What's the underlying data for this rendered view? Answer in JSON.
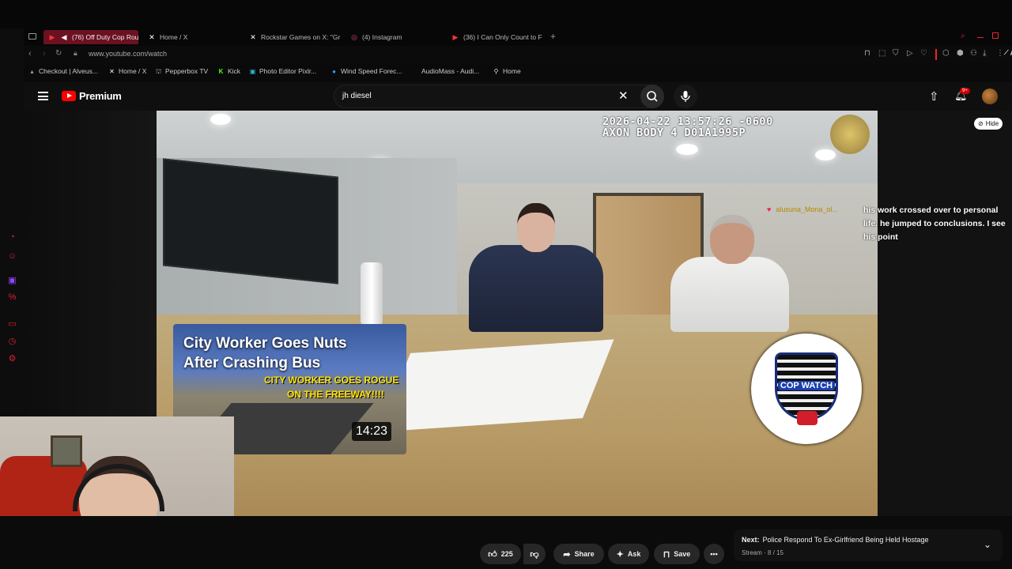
{
  "browser": {
    "tabs": [
      {
        "label": "(76) Off Duty Cop Roug",
        "icon": "youtube-icon",
        "active": true
      },
      {
        "label": "Home / X",
        "icon": "x-icon"
      },
      {
        "label": "Rockstar Games on X: \"Gr",
        "icon": "x-icon"
      },
      {
        "label": "(4) Instagram",
        "icon": "instagram-icon"
      },
      {
        "label": "(36) I Can Only Count to F",
        "icon": "youtube-icon"
      }
    ],
    "url": "www.youtube.com/watch",
    "bookmarks": [
      {
        "label": "Checkout | Alveus...",
        "icon": "shop-icon"
      },
      {
        "label": "Home / X",
        "icon": "x-icon"
      },
      {
        "label": "Pepperbox TV",
        "icon": "tv-icon"
      },
      {
        "label": "Kick",
        "icon": "kick-icon"
      },
      {
        "label": "Photo Editor Pixlr...",
        "icon": "pixlr-icon"
      },
      {
        "label": "Wind Speed Forec...",
        "icon": "globe-icon"
      },
      {
        "label": "AudioMass - Audi...",
        "icon": "audio-icon"
      },
      {
        "label": "Home",
        "icon": "pin-icon"
      }
    ],
    "ai_label": "AI",
    "accent": "#ff3040"
  },
  "youtube": {
    "brand": "Premium",
    "search_value": "jh diesel",
    "notification_count": "9+",
    "video": {
      "timestamp_line1": "2026-04-22 13:57:26 -0600",
      "timestamp_line2": "AXON BODY 4 D01A1995P",
      "hide_label": "Hide",
      "chat_user": "alusuna_Mona_ol...",
      "chat_message": "his work crossed over to personal life. he jumped to conclusions. I see his point",
      "thumbnail_title_line1": "City Worker Goes Nuts",
      "thumbnail_title_line2": "After Crashing Bus",
      "thumbnail_caption_line1": "CITY WORKER GOES ROGUE",
      "thumbnail_caption_line2": "ON THE FREEWAY!!!!",
      "thumbnail_duration": "14:23",
      "badge_text": "COP WATCH"
    },
    "actions": {
      "like_count": "225",
      "share": "Share",
      "ask": "Ask",
      "save": "Save"
    },
    "next": {
      "prefix": "Next:",
      "title": "Police Respond To Ex-Girlfriend Being Held Hostage",
      "meta": "Stream · 8 / 15"
    }
  }
}
